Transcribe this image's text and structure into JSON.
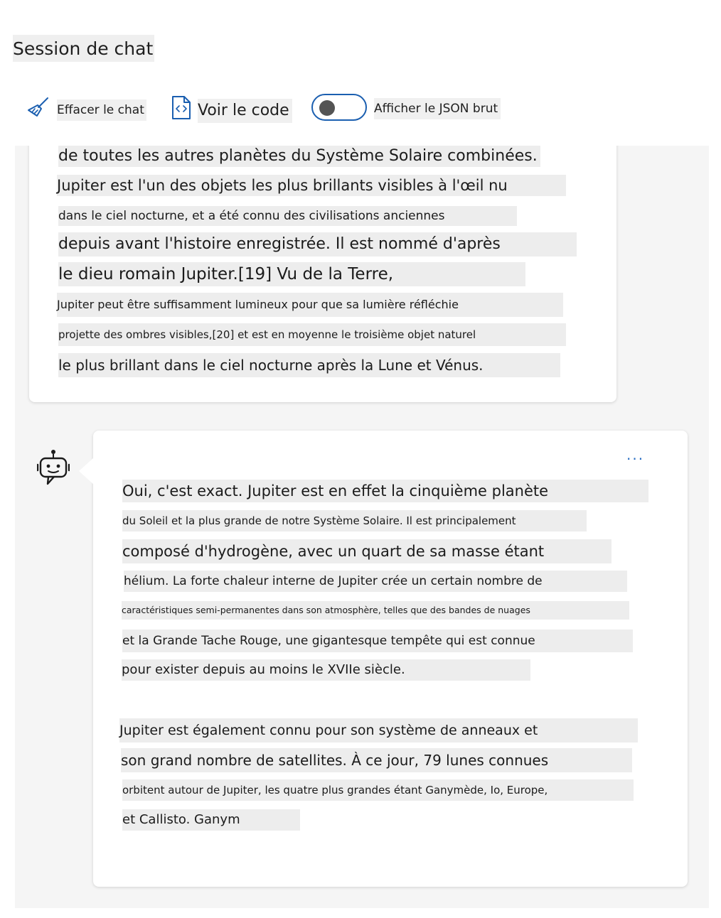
{
  "header": {
    "title": "Session de chat"
  },
  "toolbar": {
    "clear_label": "Effacer le chat",
    "clear_icon": "broom-icon",
    "code_label": "Voir le code",
    "code_icon": "code-file-icon",
    "json_toggle_label": "Afficher le JSON brut",
    "json_toggle_on": false
  },
  "colors": {
    "accent": "#1b5fb0",
    "chat_background": "#f5f5f5",
    "card_background": "#ffffff",
    "text_highlight": "#ededed"
  },
  "messages": {
    "previous": {
      "lines": [
        "de toutes les autres planètes du Système Solaire combinées.",
        "Jupiter est l'un des objets les plus brillants visibles à l'œil nu",
        "dans le ciel nocturne, et a été connu des civilisations anciennes",
        "depuis avant l'histoire enregistrée. Il est nommé d'après",
        "le dieu romain Jupiter.[19] Vu de la Terre,",
        "Jupiter peut être suffisamment lumineux pour que sa lumière réfléchie",
        "projette des ombres visibles,[20] et est en moyenne le troisième objet naturel",
        "le plus brillant dans le ciel nocturne après la Lune et Vénus."
      ]
    },
    "assistant": {
      "avatar_icon": "bot-icon",
      "more_label": "···",
      "lines": [
        "Oui, c'est exact. Jupiter est en effet la cinquième planète",
        "du Soleil et la plus grande de notre Système Solaire. Il est principalement",
        "composé d'hydrogène, avec un quart de sa masse étant",
        "hélium. La forte chaleur interne de Jupiter crée un certain nombre de",
        "caractéristiques semi-permanentes dans son atmosphère, telles que des bandes de nuages",
        "et la Grande Tache Rouge, une gigantesque tempête qui est connue",
        "pour exister depuis au moins le XVIIe siècle.",
        "Jupiter est également connu pour son système de anneaux et",
        "son grand nombre de satellites. À ce jour, 79 lunes connues",
        "orbitent autour de Jupiter, les quatre plus grandes étant Ganymède, Io, Europe,",
        "et Callisto. Ganym"
      ]
    }
  }
}
